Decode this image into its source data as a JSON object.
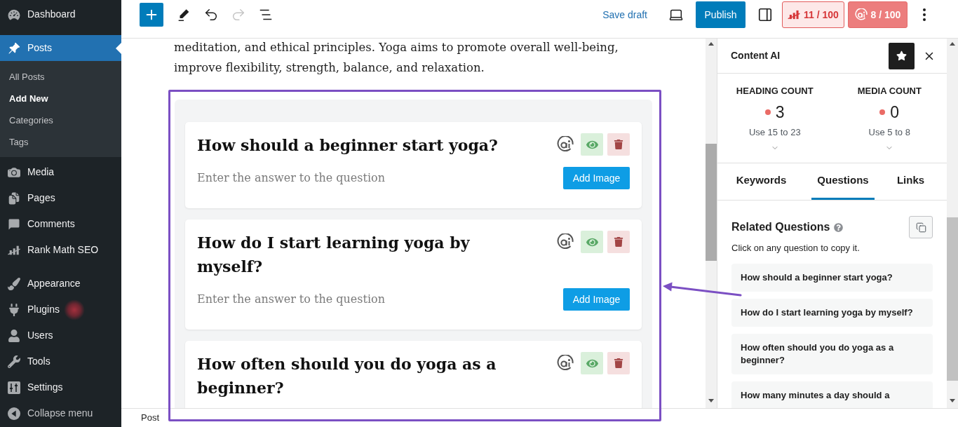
{
  "admin_menu": {
    "groups": [
      {
        "items": [
          {
            "label": "Dashboard",
            "selected": false,
            "redacted_badge": false
          }
        ]
      },
      {
        "items": [
          {
            "label": "Posts",
            "selected": true,
            "redacted_badge": false,
            "children": [
              {
                "label": "All Posts",
                "selected": false
              },
              {
                "label": "Add New",
                "selected": true
              },
              {
                "label": "Categories",
                "selected": false
              },
              {
                "label": "Tags",
                "selected": false
              }
            ]
          },
          {
            "label": "Media",
            "selected": false,
            "redacted_badge": false
          },
          {
            "label": "Pages",
            "selected": false,
            "redacted_badge": false
          },
          {
            "label": "Comments",
            "selected": false,
            "redacted_badge": false
          },
          {
            "label": "Rank Math SEO",
            "selected": false,
            "redacted_badge": false
          }
        ]
      },
      {
        "items": [
          {
            "label": "Appearance",
            "selected": false,
            "redacted_badge": false
          },
          {
            "label": "Plugins",
            "selected": false,
            "redacted_badge": true
          },
          {
            "label": "Users",
            "selected": false,
            "redacted_badge": false
          },
          {
            "label": "Tools",
            "selected": false,
            "redacted_badge": false
          },
          {
            "label": "Settings",
            "selected": false,
            "redacted_badge": false
          }
        ]
      }
    ],
    "collapse_label": "Collapse menu"
  },
  "toolbar": {
    "tools": [
      {
        "kind": "inserter",
        "disabled": false
      },
      {
        "kind": "tools",
        "disabled": false
      },
      {
        "kind": "undo",
        "disabled": false
      },
      {
        "kind": "redo",
        "disabled": true
      },
      {
        "kind": "document_overview",
        "disabled": false
      }
    ],
    "save_draft": "Save draft",
    "publish": "Publish",
    "scores": [
      {
        "kind": "seo",
        "text": "11 / 100"
      },
      {
        "kind": "content_ai",
        "text": "8 / 100"
      }
    ]
  },
  "editor": {
    "paragraph": "meditation, and ethical principles. Yoga aims to promote overall well-being, improve flexibility, strength, balance, and relaxation.",
    "faq_block": {
      "questions": [
        {
          "title": "How should a beginner start yoga?",
          "visible": true,
          "answer": {
            "placeholder": "Enter the answer to the question"
          },
          "add_image": "Add Image"
        },
        {
          "title": "How do I start learning yoga by myself?",
          "visible": true,
          "answer": {
            "placeholder": "Enter the answer to the question"
          },
          "add_image": "Add Image"
        },
        {
          "title": "How often should you do yoga as a beginner?",
          "visible": true
        }
      ]
    }
  },
  "content_ai_panel": {
    "title": "Content AI",
    "pinned": true,
    "stats": [
      {
        "label": "HEADING COUNT",
        "value": "3",
        "color": "#ea6b66",
        "hint": "Use 15 to 23",
        "expanded": false
      },
      {
        "label": "MEDIA COUNT",
        "value": "0",
        "color": "#ea6b66",
        "hint": "Use 5 to 8",
        "expanded": false
      }
    ],
    "tabs": [
      {
        "label": "Keywords",
        "selected": false
      },
      {
        "label": "Questions",
        "selected": true
      },
      {
        "label": "Links",
        "selected": false
      }
    ],
    "related_questions": {
      "heading": "Related Questions",
      "description": "Click on any question to copy it.",
      "items": [
        "How should a beginner start yoga?",
        "How do I start learning yoga by myself?",
        "How often should you do yoga as a beginner?",
        "How many minutes a day should a"
      ]
    }
  },
  "status_bar": {
    "breadcrumb": "Post"
  },
  "annotation": {
    "highlight_frame": true,
    "arrow": true
  }
}
